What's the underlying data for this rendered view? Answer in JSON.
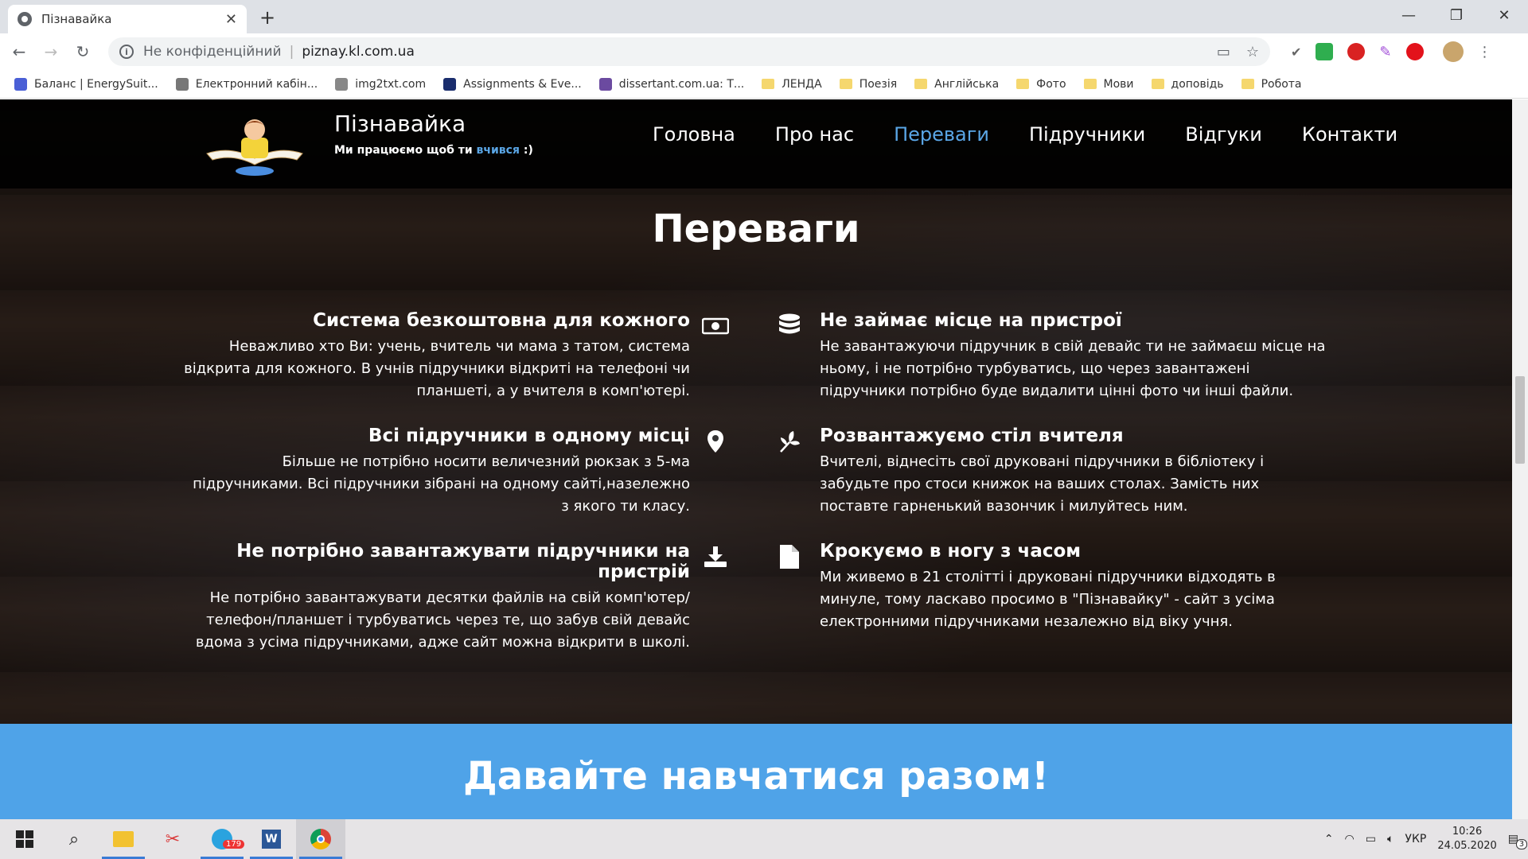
{
  "browser": {
    "tab_title": "Пізнавайка",
    "security_label": "Не конфіденційний",
    "url": "piznay.kl.com.ua"
  },
  "bookmarks": [
    {
      "label": "Баланс | EnergySuit...",
      "type": "site"
    },
    {
      "label": "Електронний кабін...",
      "type": "site"
    },
    {
      "label": "img2txt.com",
      "type": "site"
    },
    {
      "label": "Assignments & Eve...",
      "type": "site"
    },
    {
      "label": "dissertant.com.ua: Т...",
      "type": "site"
    },
    {
      "label": "ЛЕНДА",
      "type": "folder"
    },
    {
      "label": "Поезія",
      "type": "folder"
    },
    {
      "label": "Англійська",
      "type": "folder"
    },
    {
      "label": "Фото",
      "type": "folder"
    },
    {
      "label": "Мови",
      "type": "folder"
    },
    {
      "label": "доповідь",
      "type": "folder"
    },
    {
      "label": "Робота",
      "type": "folder"
    }
  ],
  "site": {
    "brand": "Пізнавайка",
    "tagline_pre": "Ми працюємо щоб ти ",
    "tagline_hl": "вчився",
    "tagline_post": " :)",
    "nav": [
      "Головна",
      "Про нас",
      "Переваги",
      "Підручники",
      "Відгуки",
      "Контакти"
    ],
    "active_nav": "Переваги",
    "section_title": "Переваги",
    "features": [
      {
        "icon": "money-icon",
        "title": "Система безкоштовна для кожного",
        "text": "Неважливо хто Ви: учень, вчитель чи мама з татом, система відкрита для кожного. В учнів підручники відкриті на телефоні чи планшеті, а у вчителя в комп'ютері."
      },
      {
        "icon": "database-icon",
        "title": "Не займає місце на пристрої",
        "text": "Не завантажуючи підручник в свій девайс ти не займаєш місце на ньому, і не потрібно турбуватись, що через завантажені підручники потрібно буде видалити цінні фото чи інші файли."
      },
      {
        "icon": "map-marker-icon",
        "title": "Всі підручники в одному місці",
        "text": "Більше не потрібно носити величезний рюкзак з 5-ма підручниками. Всі підручники зібрані на одному сайті,назележно з якого ти класу."
      },
      {
        "icon": "leaf-icon",
        "title": "Розвантажуємо стіл вчителя",
        "text": "Вчителі, віднесіть свої друковані підручники в бібліотеку і забудьте про стоси книжок на ваших столах. Замість них поставте гарненький вазончик і милуйтесь ним."
      },
      {
        "icon": "download-icon",
        "title": "Не потрібно завантажувати підручники на пристрій",
        "text": "Не потрібно завантажувати десятки файлів на свій комп'ютер/телефон/планшет і турбуватись через те, що забув свій девайс вдома з усіма підручниками, адже сайт можна відкрити в школі."
      },
      {
        "icon": "file-icon",
        "title": "Крокуємо в ногу з часом",
        "text": "Ми живемо в 21 столітті і друковані підручники відходять в минуле, тому ласкаво просимо в \"Пізнавайку\" - сайт з усіма електронними підручниками незалежно від віку учня."
      }
    ],
    "cta": "Давайте навчатися разом!"
  },
  "taskbar": {
    "telegram_badge": "179",
    "lang": "УКР",
    "time": "10:26",
    "date": "24.05.2020",
    "notifications": "3"
  },
  "colors": {
    "accent": "#5aa6e6",
    "band": "#4fa3e8"
  }
}
